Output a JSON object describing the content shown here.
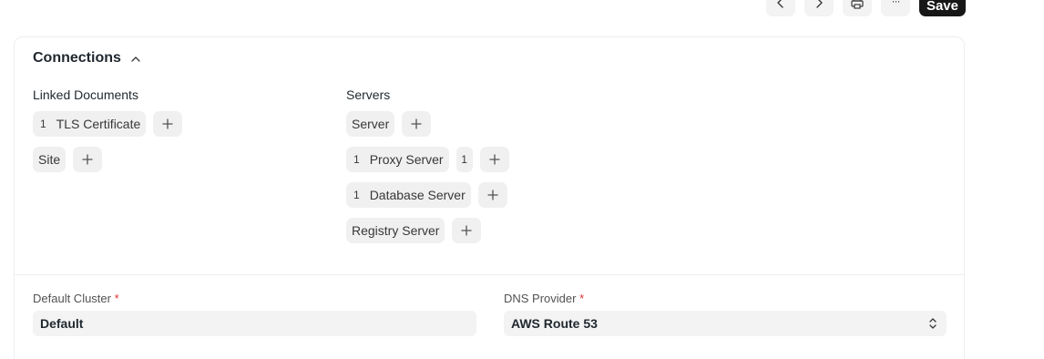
{
  "toolbar": {
    "prev_icon": "chevron-left-icon",
    "next_icon": "chevron-right-icon",
    "print_icon": "printer-icon",
    "more_label": "···",
    "save_label": "Save"
  },
  "connections": {
    "title": "Connections",
    "linked_documents": {
      "title": "Linked Documents",
      "items": [
        {
          "count": "1",
          "label": "TLS Certificate"
        },
        {
          "count": "",
          "label": "Site"
        }
      ]
    },
    "servers": {
      "title": "Servers",
      "items": [
        {
          "count": "",
          "label": "Server",
          "extra": ""
        },
        {
          "count": "1",
          "label": "Proxy Server",
          "extra": "1"
        },
        {
          "count": "1",
          "label": "Database Server",
          "extra": ""
        },
        {
          "count": "",
          "label": "Registry Server",
          "extra": ""
        }
      ]
    }
  },
  "fields": {
    "default_cluster": {
      "label": "Default Cluster",
      "required": "*",
      "value": "Default"
    },
    "dns_provider": {
      "label": "DNS Provider",
      "required": "*",
      "value": "AWS Route 53"
    }
  }
}
